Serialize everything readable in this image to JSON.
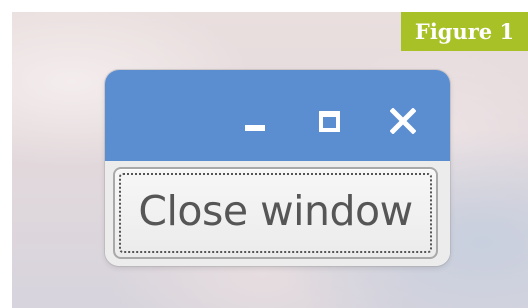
{
  "figure_label": "Figure 1",
  "window": {
    "titlebar_color": "#5b8dd1",
    "controls": {
      "minimize_icon": "minimize-icon",
      "maximize_icon": "maximize-icon",
      "close_icon": "close-icon"
    },
    "button_label": "Close window"
  },
  "colors": {
    "badge": "#a7c127",
    "window_background": "#ececec"
  }
}
